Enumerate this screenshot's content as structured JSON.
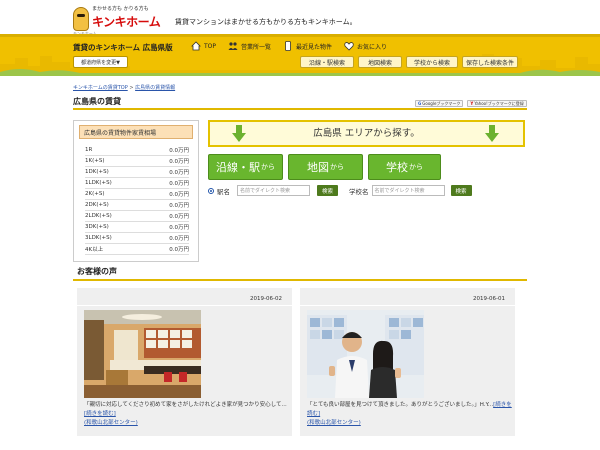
{
  "header": {
    "logo_tagline": "まかせる方も かりる方も",
    "logo_name": "キンキホーム",
    "logo_sub": "キンキホーム",
    "catchphrase": "賃貸マンションはまかせる方もかりる方もキンキホーム。"
  },
  "nav": {
    "site_title": "賃貸のキンキホーム 広島県版",
    "links": [
      "TOP",
      "営業所一覧",
      "最近見た物件",
      "お気に入り"
    ],
    "pref_button": "都道府県を変更▼",
    "quick": [
      "沿線・駅検索",
      "地図検索",
      "学校から検索",
      "保存した検索条件"
    ]
  },
  "breadcrumb": {
    "home": "キンキホームの賃貸TOP",
    "sep": ">",
    "current": "広島県の賃貸情報"
  },
  "page_title": "広島県の賃貸",
  "bookmarks": [
    "Googleブックマーク",
    "Yahoo!ブックマークに登録"
  ],
  "price_box": {
    "title": "広島県の賃貸物件家賃相場",
    "rows": [
      {
        "type": "1R",
        "price": "0.0万円"
      },
      {
        "type": "1K(+S)",
        "price": "0.0万円"
      },
      {
        "type": "1DK(+S)",
        "price": "0.0万円"
      },
      {
        "type": "1LDK(+S)",
        "price": "0.0万円"
      },
      {
        "type": "2K(+S)",
        "price": "0.0万円"
      },
      {
        "type": "2DK(+S)",
        "price": "0.0万円"
      },
      {
        "type": "2LDK(+S)",
        "price": "0.0万円"
      },
      {
        "type": "3DK(+S)",
        "price": "0.0万円"
      },
      {
        "type": "3LDK(+S)",
        "price": "0.0万円"
      },
      {
        "type": "4K以上",
        "price": "0.0万円"
      }
    ]
  },
  "search": {
    "area_bar": "広島県 エリアから探す。",
    "buttons": [
      {
        "main": "沿線・駅",
        "sub": "から"
      },
      {
        "main": "地図",
        "sub": "から"
      },
      {
        "main": "学校",
        "sub": "から"
      }
    ],
    "station_label": "駅名",
    "station_placeholder": "名前でダイレクト検索",
    "school_label": "学校名",
    "school_placeholder": "名前でダイレクト検索",
    "go_label": "検索"
  },
  "voices": {
    "title": "お客様の声",
    "cards": [
      {
        "date": "2019-06-02",
        "text": "「親切に対応してくださり初めて家をさがしたけれどよき家が見つかり安心して...",
        "more": "[続きを読む]",
        "branch": "(和歌山北部センター)"
      },
      {
        "date": "2019-06-01",
        "text": "「とても良い部屋を見つけて頂きました。ありがとうございました。」H.Y...",
        "more": "[続きを読む]",
        "branch": "(和歌山北部センター)"
      }
    ]
  },
  "colors": {
    "band": "#f0c000",
    "green_button": "#69b62e",
    "go_button": "#4e7a1d",
    "logo_red": "#d60b0b"
  }
}
